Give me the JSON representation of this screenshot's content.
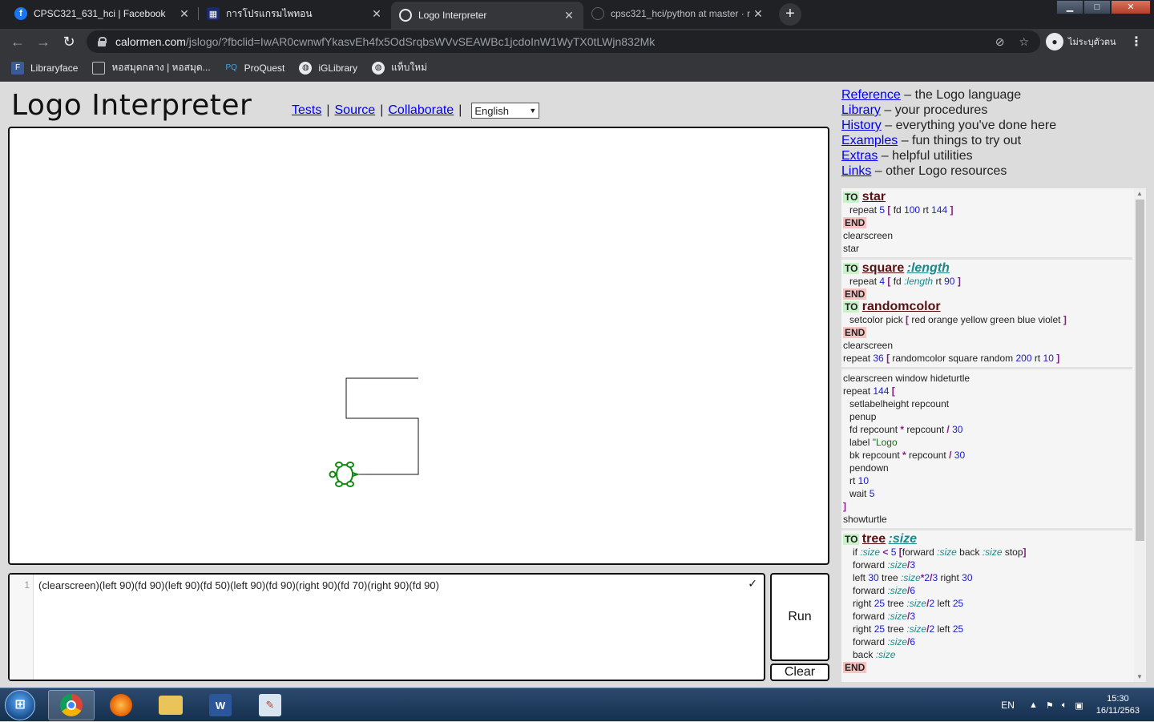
{
  "browser": {
    "tabs": [
      {
        "title": "CPSC321_631_hci | Facebook",
        "icon": "facebook-icon"
      },
      {
        "title": "การโปรแกรมไพทอน",
        "icon": "site-icon"
      },
      {
        "title": "Logo Interpreter",
        "icon": "logo-icon"
      },
      {
        "title": "cpsc321_hci/python at master · n",
        "icon": "github-icon"
      }
    ],
    "window_buttons": {
      "minimize": "▁",
      "maximize": "□",
      "close": "✕"
    },
    "url_host": "calormen.com",
    "url_path": "/jslogo/?fbclid=IwAR0cwnwfYkasvEh4fx5OdSrqbsWVvSEAWBc1jcdoInW1WyTX0tLWjn832Mk",
    "profile_label": "ไม่ระบุตัวตน",
    "bookmarks": [
      "Libraryface",
      "หอสมุดกลาง | หอสมุด...",
      "ProQuest",
      "iGLibrary",
      "แท็บใหม่"
    ]
  },
  "header": {
    "title": "Logo Interpreter",
    "links": [
      "Tests",
      "Source",
      "Collaborate"
    ],
    "language": "English"
  },
  "reference": [
    {
      "link": "Reference",
      "desc": " – the Logo language"
    },
    {
      "link": "Library",
      "desc": " – your procedures"
    },
    {
      "link": "History",
      "desc": " – everything you've done here"
    },
    {
      "link": "Examples",
      "desc": " – fun things to try out"
    },
    {
      "link": "Extras",
      "desc": " – helpful utilities"
    },
    {
      "link": "Links",
      "desc": " – other Logo resources"
    }
  ],
  "library": {
    "to": "TO",
    "end": "END",
    "star": {
      "name": "star",
      "body": "repeat 5 [ fd 100 rt 144 ]",
      "after": [
        "clearscreen",
        "star"
      ]
    },
    "square": {
      "name": "square",
      "param": ":length"
    },
    "randomcolor": {
      "name": "randomcolor"
    },
    "square_after": [
      "clearscreen"
    ],
    "snippet3": [
      "clearscreen window hideturtle",
      "setlabelheight repcount",
      "penup",
      "pendown",
      "showturtle"
    ],
    "tree": {
      "name": "tree",
      "param": ":size"
    }
  },
  "editor": {
    "line_number": "1",
    "code": "(clearscreen)(left 90)(fd 90)(left 90)(fd 50)(left 90)(fd 90)(right 90)(fd 70)(right 90)(fd 90)"
  },
  "buttons": {
    "run": "Run",
    "clear": "Clear"
  },
  "taskbar": {
    "lang": "EN",
    "time": "15:30",
    "date": "16/11/2563"
  },
  "colors": {
    "link": "#0000ee",
    "turtle": "#118811",
    "to_bg": "#c9f2c9",
    "end_bg": "#f6c3c3"
  }
}
